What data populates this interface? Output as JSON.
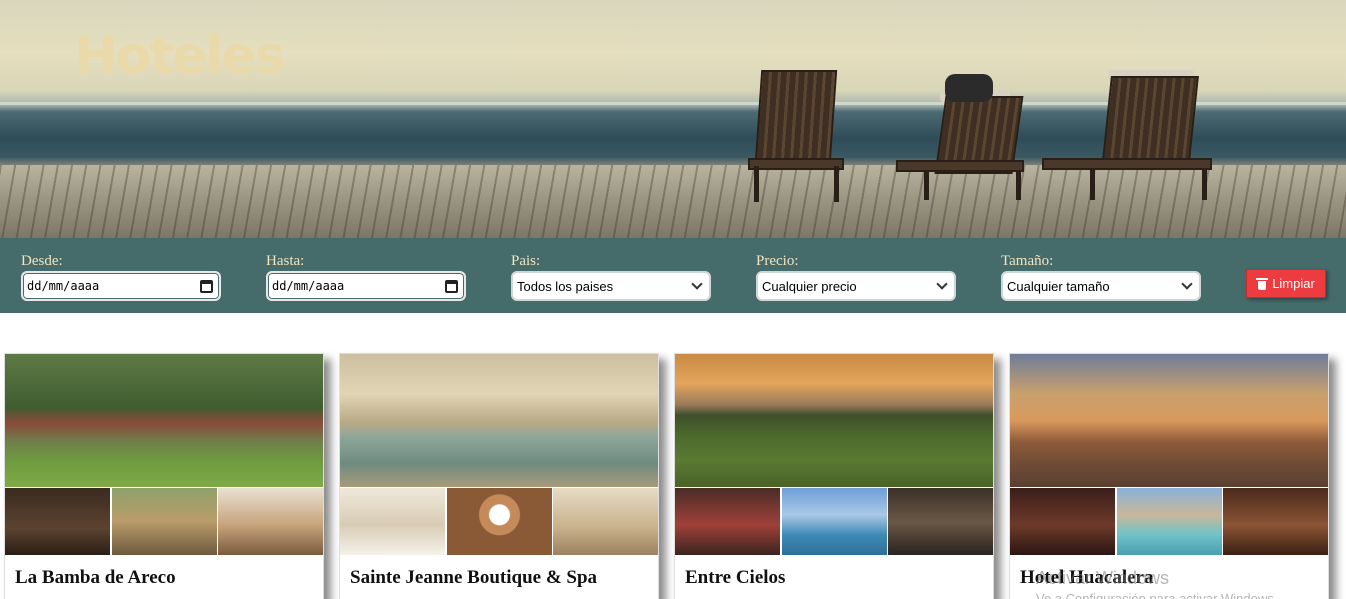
{
  "hero": {
    "title": "Hoteles"
  },
  "filters": {
    "desde": {
      "label": "Desde:",
      "placeholder": "dd/mm/aaaa"
    },
    "hasta": {
      "label": "Hasta:",
      "placeholder": "dd/mm/aaaa"
    },
    "pais": {
      "label": "Pais:",
      "selected": "Todos los paises"
    },
    "precio": {
      "label": "Precio:",
      "selected": "Cualquier precio"
    },
    "tamano": {
      "label": "Tamaño:",
      "selected": "Cualquier tamaño"
    },
    "clear_label": "Limpiar",
    "clear_color": "#ec3c3f",
    "bar_color": "#456b6a",
    "label_color": "#f1e5bf"
  },
  "hotels": [
    {
      "name": "La Bamba de Areco"
    },
    {
      "name": "Sainte Jeanne Boutique & Spa"
    },
    {
      "name": "Entre Cielos"
    },
    {
      "name": "Hotel Huacalera"
    }
  ],
  "overlay": {
    "watermark": "Activar Windows",
    "watermark_sub": "Ve a Configuración para activar Windows."
  }
}
